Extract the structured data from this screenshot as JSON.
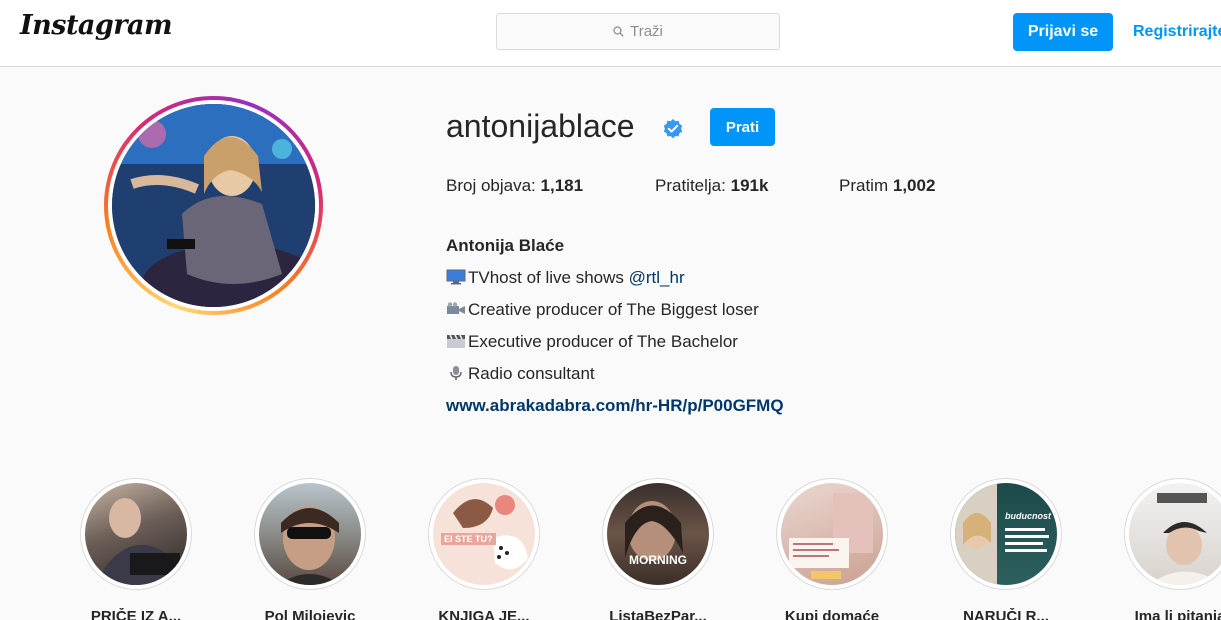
{
  "header": {
    "logo": "Instagram",
    "search_placeholder": "Traži",
    "login_label": "Prijavi se",
    "register_label": "Registrirajte se"
  },
  "profile": {
    "username": "antonijablace",
    "verified_icon": "verified-badge-icon",
    "follow_label": "Prati",
    "stats": {
      "posts_label": "Broj objava:",
      "posts_value": "1,181",
      "followers_label": "Pratitelja:",
      "followers_value": "191k",
      "following_label": "Pratim",
      "following_value": "1,002"
    },
    "bio": {
      "name": "Antonija Blaće",
      "line1_text": "TVhost of live shows ",
      "line1_mention": "@rtl_hr",
      "line2": "Creative producer of The Biggest loser",
      "line3": "Executive producer of The Bachelor",
      "line4": "Radio consultant",
      "link": "www.abrakadabra.com/hr-HR/p/P00GFMQ"
    }
  },
  "highlights": [
    {
      "label": "PRIČE IZ A...",
      "tag": ""
    },
    {
      "label": "Pol Milojevic",
      "tag": ""
    },
    {
      "label": "KNJIGA JE...",
      "tag": "EI STE TU?"
    },
    {
      "label": "ListaBezPar...",
      "tag": "MORNING"
    },
    {
      "label": "Kupi domaće",
      "tag": ""
    },
    {
      "label": "NARUČI R...",
      "tag": "buducnost"
    },
    {
      "label": "Ima li pitanja",
      "tag": ""
    }
  ],
  "colors": {
    "accent": "#0095f6",
    "link": "#00376b",
    "border": "#dbdbdb",
    "background": "#fafafa"
  }
}
